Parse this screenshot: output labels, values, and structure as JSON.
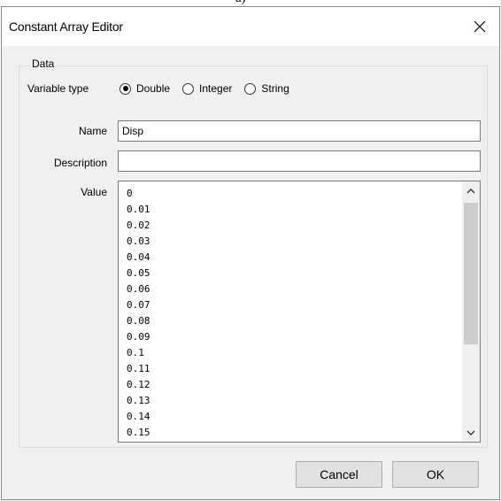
{
  "caption": "a)",
  "window": {
    "title": "Constant Array Editor",
    "close_icon": "close-icon"
  },
  "group": {
    "legend": "Data"
  },
  "variable_type": {
    "label": "Variable type",
    "options": [
      "Double",
      "Integer",
      "String"
    ],
    "selected": "Double"
  },
  "name_field": {
    "label": "Name",
    "value": "Disp"
  },
  "description_field": {
    "label": "Description",
    "value": ""
  },
  "value_field": {
    "label": "Value",
    "lines": [
      "0",
      "0.01",
      "0.02",
      "0.03",
      "0.04",
      "0.05",
      "0.06",
      "0.07",
      "0.08",
      "0.09",
      "0.1",
      "0.11",
      "0.12",
      "0.13",
      "0.14",
      "0.15"
    ]
  },
  "buttons": {
    "cancel": "Cancel",
    "ok": "OK"
  }
}
